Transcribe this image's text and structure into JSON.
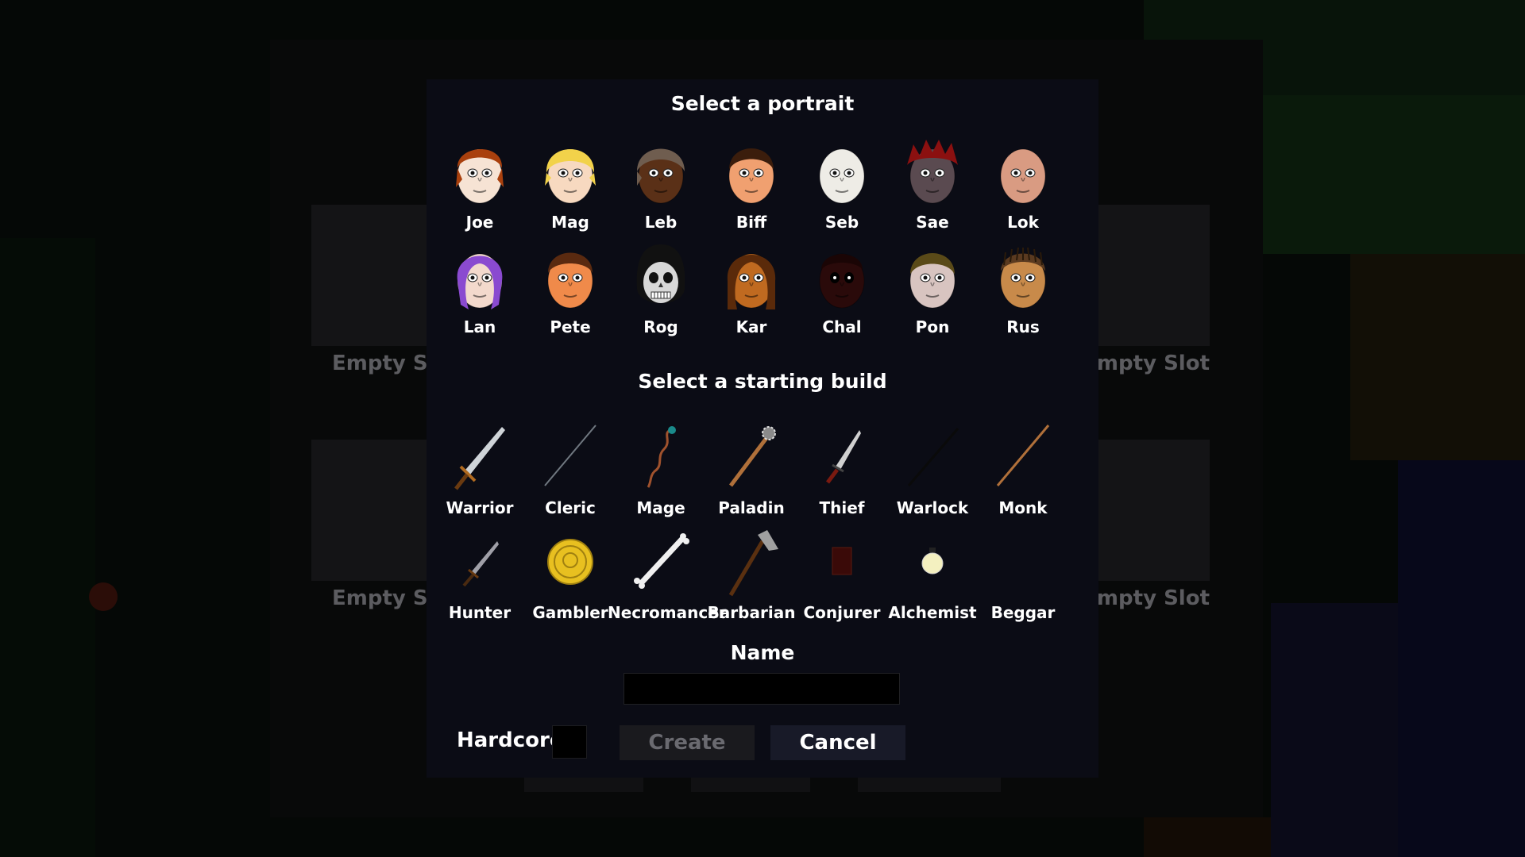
{
  "background": {
    "slot_labels": [
      "Empty Slot",
      "Empty Slot",
      "Empty Slot",
      "Empty Slot"
    ]
  },
  "modal": {
    "portrait_title": "Select a portrait",
    "portraits": [
      {
        "name": "Joe",
        "skin": "#f6e3d4",
        "hair": "#a9400d",
        "icon": "portrait-joe-icon"
      },
      {
        "name": "Mag",
        "skin": "#f7d9c0",
        "hair": "#f2d24a",
        "icon": "portrait-mag-icon"
      },
      {
        "name": "Leb",
        "skin": "#5a3017",
        "hair": "#6f5d4f",
        "icon": "portrait-leb-icon"
      },
      {
        "name": "Biff",
        "skin": "#f0a070",
        "hair": "#3b1d0c",
        "icon": "portrait-biff-icon"
      },
      {
        "name": "Seb",
        "skin": "#eeece6",
        "hair": "#eeece6",
        "icon": "portrait-seb-icon"
      },
      {
        "name": "Sae",
        "skin": "#5a4a50",
        "hair": "#8b1010",
        "icon": "portrait-sae-icon"
      },
      {
        "name": "Lok",
        "skin": "#d99b82",
        "hair": "#d99b82",
        "icon": "portrait-lok-icon"
      },
      {
        "name": "Lan",
        "skin": "#f3d9cc",
        "hair": "#8a4ad0",
        "icon": "portrait-lan-icon"
      },
      {
        "name": "Pete",
        "skin": "#f08a4a",
        "hair": "#5a2a10",
        "icon": "portrait-pete-icon"
      },
      {
        "name": "Rog",
        "skin": "#d8d8d8",
        "hair": "#111111",
        "icon": "portrait-rog-skull-icon"
      },
      {
        "name": "Kar",
        "skin": "#c06a20",
        "hair": "#5a2a0a",
        "icon": "portrait-kar-icon"
      },
      {
        "name": "Chal",
        "skin": "#2a0a0a",
        "hair": "#1a0505",
        "icon": "portrait-chal-icon"
      },
      {
        "name": "Pon",
        "skin": "#d8c4c0",
        "hair": "#5a4a18",
        "icon": "portrait-pon-icon"
      },
      {
        "name": "Rus",
        "skin": "#c88a4a",
        "hair": "#5a3a20",
        "icon": "portrait-rus-icon"
      }
    ],
    "build_title": "Select a starting build",
    "builds": [
      {
        "name": "Warrior",
        "icon": "sword-icon"
      },
      {
        "name": "Cleric",
        "icon": "staff-icon"
      },
      {
        "name": "Mage",
        "icon": "wand-icon"
      },
      {
        "name": "Paladin",
        "icon": "mace-icon"
      },
      {
        "name": "Thief",
        "icon": "dagger-icon"
      },
      {
        "name": "Warlock",
        "icon": "dark-staff-icon"
      },
      {
        "name": "Monk",
        "icon": "quarterstaff-icon"
      },
      {
        "name": "Hunter",
        "icon": "short-sword-icon"
      },
      {
        "name": "Gambler",
        "icon": "gold-coin-icon"
      },
      {
        "name": "Necromancer",
        "icon": "bone-icon"
      },
      {
        "name": "Barbarian",
        "icon": "axe-icon"
      },
      {
        "name": "Conjurer",
        "icon": "spellbook-icon"
      },
      {
        "name": "Alchemist",
        "icon": "potion-icon"
      },
      {
        "name": "Beggar",
        "icon": "empty-icon"
      }
    ],
    "name_label": "Name",
    "name_value": "",
    "hardcore_label": "Hardcore",
    "create_label": "Create",
    "cancel_label": "Cancel"
  }
}
